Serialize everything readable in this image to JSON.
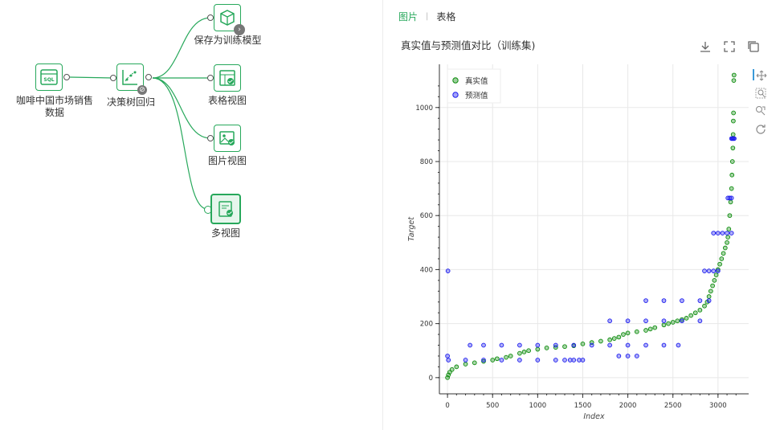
{
  "workflow": {
    "nodes": [
      {
        "id": "source",
        "label": "咖啡中国市场销售\n数据",
        "label_line1": "咖啡中国市场销售",
        "label_line2": "数据",
        "icon": "sql-icon"
      },
      {
        "id": "dt",
        "label": "决策树回归",
        "icon": "decision-tree-icon"
      },
      {
        "id": "save",
        "label": "保存为训练模型",
        "icon": "cube-icon"
      },
      {
        "id": "table",
        "label": "表格视图",
        "icon": "table-chart-icon"
      },
      {
        "id": "image",
        "label": "图片视图",
        "icon": "image-chart-icon"
      },
      {
        "id": "multi",
        "label": "多视图",
        "icon": "multi-view-icon"
      }
    ]
  },
  "tabs": {
    "active": "图片",
    "other": "表格"
  },
  "chart_header": {
    "title": "真实值与预测值对比（训练集)"
  },
  "toolbar": [
    "download-icon",
    "fullscreen-icon",
    "copy-icon"
  ],
  "side_tools": [
    "pan-icon",
    "box-zoom-icon",
    "wheel-zoom-icon",
    "reset-icon"
  ],
  "chart_data": {
    "type": "scatter",
    "xlabel": "Index",
    "ylabel": "Target",
    "xlim": [
      -90,
      3340
    ],
    "ylim": [
      -60,
      1160
    ],
    "x_ticks": [
      0,
      500,
      1000,
      1500,
      2000,
      2500,
      3000
    ],
    "y_ticks": [
      0,
      200,
      400,
      600,
      800,
      1000
    ],
    "legend_position": "top-left",
    "grid": true,
    "series": [
      {
        "name": "真实值",
        "color": "#0a8a0a",
        "points": [
          [
            0,
            0
          ],
          [
            10,
            10
          ],
          [
            25,
            20
          ],
          [
            50,
            30
          ],
          [
            100,
            40
          ],
          [
            200,
            50
          ],
          [
            300,
            55
          ],
          [
            400,
            60
          ],
          [
            500,
            65
          ],
          [
            550,
            70
          ],
          [
            650,
            75
          ],
          [
            700,
            80
          ],
          [
            800,
            90
          ],
          [
            850,
            95
          ],
          [
            900,
            100
          ],
          [
            1000,
            105
          ],
          [
            1100,
            110
          ],
          [
            1200,
            112
          ],
          [
            1300,
            115
          ],
          [
            1400,
            118
          ],
          [
            1500,
            125
          ],
          [
            1600,
            130
          ],
          [
            1700,
            135
          ],
          [
            1800,
            140
          ],
          [
            1850,
            145
          ],
          [
            1900,
            150
          ],
          [
            1950,
            160
          ],
          [
            2000,
            165
          ],
          [
            2100,
            170
          ],
          [
            2200,
            175
          ],
          [
            2250,
            180
          ],
          [
            2300,
            185
          ],
          [
            2400,
            195
          ],
          [
            2450,
            200
          ],
          [
            2500,
            205
          ],
          [
            2550,
            210
          ],
          [
            2600,
            215
          ],
          [
            2650,
            220
          ],
          [
            2700,
            230
          ],
          [
            2750,
            240
          ],
          [
            2800,
            250
          ],
          [
            2850,
            265
          ],
          [
            2880,
            280
          ],
          [
            2900,
            300
          ],
          [
            2920,
            320
          ],
          [
            2940,
            340
          ],
          [
            2960,
            360
          ],
          [
            2980,
            380
          ],
          [
            3000,
            400
          ],
          [
            3020,
            420
          ],
          [
            3040,
            440
          ],
          [
            3060,
            460
          ],
          [
            3080,
            480
          ],
          [
            3100,
            500
          ],
          [
            3110,
            520
          ],
          [
            3120,
            550
          ],
          [
            3130,
            600
          ],
          [
            3140,
            650
          ],
          [
            3150,
            700
          ],
          [
            3155,
            750
          ],
          [
            3160,
            800
          ],
          [
            3165,
            850
          ],
          [
            3168,
            900
          ],
          [
            3170,
            950
          ],
          [
            3172,
            980
          ],
          [
            3175,
            1100
          ],
          [
            3178,
            1120
          ]
        ]
      },
      {
        "name": "预测值",
        "color": "#1a1aee",
        "points": [
          [
            0,
            80
          ],
          [
            5,
            395
          ],
          [
            10,
            65
          ],
          [
            200,
            65
          ],
          [
            400,
            65
          ],
          [
            600,
            65
          ],
          [
            800,
            65
          ],
          [
            1000,
            65
          ],
          [
            1200,
            65
          ],
          [
            1300,
            65
          ],
          [
            1360,
            65
          ],
          [
            1400,
            65
          ],
          [
            1460,
            65
          ],
          [
            1500,
            65
          ],
          [
            250,
            120
          ],
          [
            400,
            120
          ],
          [
            600,
            120
          ],
          [
            800,
            120
          ],
          [
            1000,
            120
          ],
          [
            1200,
            120
          ],
          [
            1400,
            120
          ],
          [
            1600,
            120
          ],
          [
            1800,
            120
          ],
          [
            2000,
            120
          ],
          [
            2200,
            120
          ],
          [
            2400,
            120
          ],
          [
            2560,
            120
          ],
          [
            1900,
            80
          ],
          [
            2000,
            80
          ],
          [
            2100,
            80
          ],
          [
            1800,
            210
          ],
          [
            2000,
            210
          ],
          [
            2200,
            210
          ],
          [
            2400,
            210
          ],
          [
            2600,
            210
          ],
          [
            2800,
            210
          ],
          [
            2200,
            285
          ],
          [
            2400,
            285
          ],
          [
            2600,
            285
          ],
          [
            2800,
            285
          ],
          [
            2900,
            285
          ],
          [
            2850,
            395
          ],
          [
            2900,
            395
          ],
          [
            2950,
            395
          ],
          [
            3000,
            395
          ],
          [
            2950,
            535
          ],
          [
            3000,
            535
          ],
          [
            3050,
            535
          ],
          [
            3100,
            535
          ],
          [
            3150,
            535
          ],
          [
            3110,
            665
          ],
          [
            3130,
            665
          ],
          [
            3150,
            665
          ],
          [
            3150,
            885
          ],
          [
            3160,
            885
          ],
          [
            3170,
            885
          ],
          [
            3180,
            885
          ]
        ]
      }
    ]
  }
}
